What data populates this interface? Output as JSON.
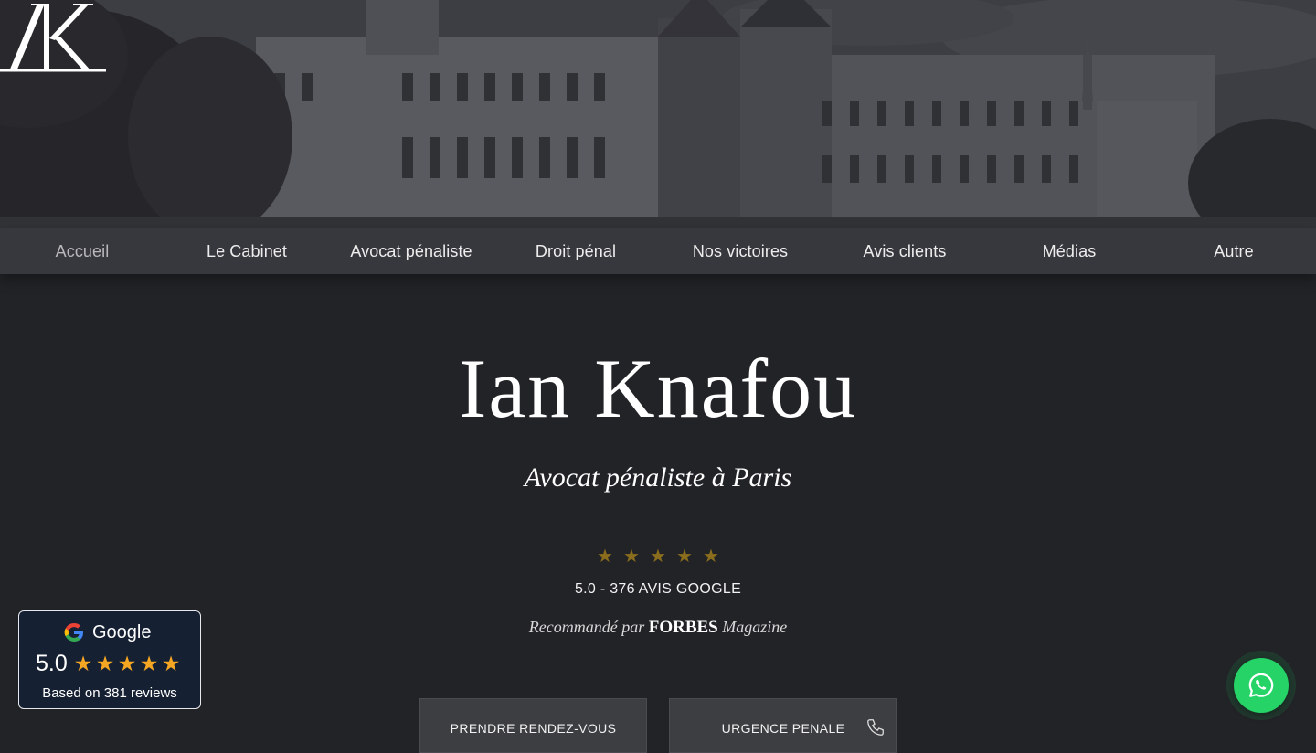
{
  "hero": {
    "logo_alt": "IK"
  },
  "nav": {
    "items": [
      {
        "label": "Accueil",
        "active": true
      },
      {
        "label": "Le Cabinet"
      },
      {
        "label": "Avocat pénaliste"
      },
      {
        "label": "Droit pénal"
      },
      {
        "label": "Nos victoires"
      },
      {
        "label": "Avis clients"
      },
      {
        "label": "Médias"
      },
      {
        "label": "Autre"
      }
    ]
  },
  "main": {
    "title": "Ian Knafou",
    "subtitle": "Avocat pénaliste à Paris",
    "stars": "★★★★★",
    "rating_text": "5.0 - 376 AVIS GOOGLE",
    "recommended_prefix": "Recommandé par",
    "recommended_brand": "FORBES",
    "recommended_suffix": "Magazine",
    "buttons": {
      "appointment": "PRENDRE RENDEZ-VOUS",
      "emergency": "URGENCE PENALE"
    }
  },
  "google_widget": {
    "brand": "Google",
    "score": "5.0",
    "stars": 5,
    "reviews": "Based on 381 reviews"
  },
  "colors": {
    "page_bg": "#222327",
    "nav_bg": "#37383d",
    "gold_star": "#8a6d1d",
    "google_star": "#f5a623",
    "whatsapp": "#25d366",
    "widget_bg": "#152033"
  },
  "icons": [
    "google-g-icon",
    "star-icon",
    "phone-icon",
    "whatsapp-icon"
  ]
}
